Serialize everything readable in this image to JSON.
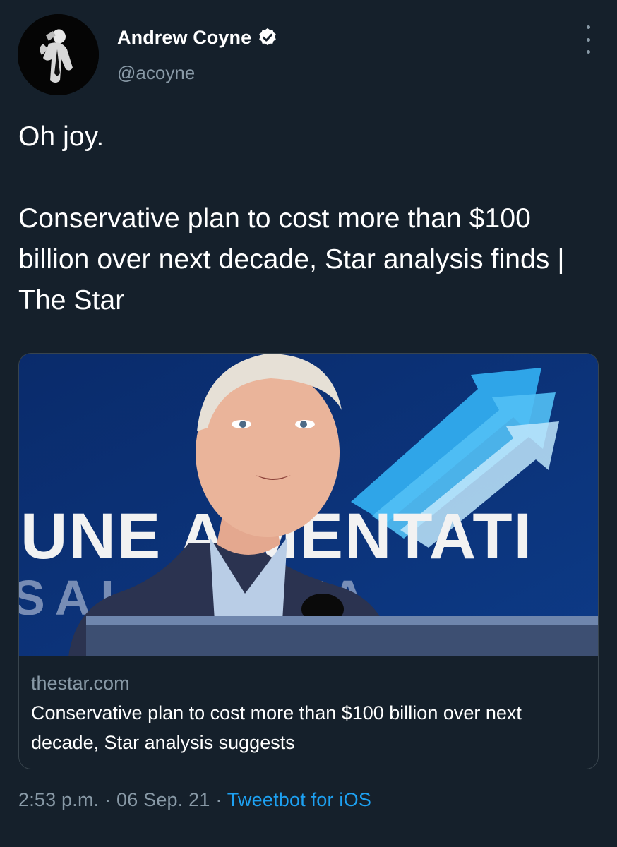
{
  "author": {
    "display_name": "Andrew Coyne",
    "handle": "@acoyne",
    "verified": true
  },
  "tweet": {
    "line_1": "Oh joy.",
    "line_2": "Conservative plan to cost more than $100 billion over next decade, Star analysis finds | The Star"
  },
  "card": {
    "image_sign_line_1": "UNE A MENTATI",
    "image_sign_line_2": "SAL TRAVA",
    "domain": "thestar.com",
    "title": "Conservative plan to cost more than $100 billion over next decade, Star analysis suggests"
  },
  "footer": {
    "time": "2:53 p.m.",
    "date": "06 Sep. 21",
    "separator": "·",
    "source": "Tweetbot for iOS"
  },
  "colors": {
    "background": "#15202b",
    "secondary_text": "#8899a6",
    "link": "#1da1f2",
    "border": "#38444d"
  },
  "icons": {
    "verified": "verified-badge-icon",
    "more": "more-options-icon"
  }
}
